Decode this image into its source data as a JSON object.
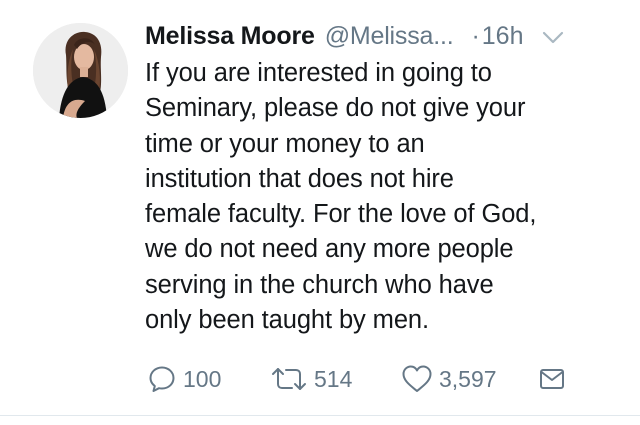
{
  "tweet": {
    "display_name": "Melissa Moore",
    "handle": "@Melissa...",
    "separator": "·",
    "time": "16h",
    "text_lines": [
      "If you are interested in going to",
      "Seminary, please do not give your",
      "time or your money to an",
      "institution that does not hire",
      "female faculty. For the love of God,",
      "we do not need any more people",
      "serving in the church who have",
      "only been taught by men."
    ]
  },
  "actions": {
    "reply_count": "100",
    "retweet_count": "514",
    "like_count": "3,597"
  },
  "icons": {
    "reply": "reply-icon",
    "retweet": "retweet-icon",
    "like": "heart-icon",
    "message": "envelope-icon",
    "caret": "chevron-down-icon"
  },
  "colors": {
    "text": "#14171a",
    "secondary": "#657786",
    "divider": "#e1e8ed"
  }
}
